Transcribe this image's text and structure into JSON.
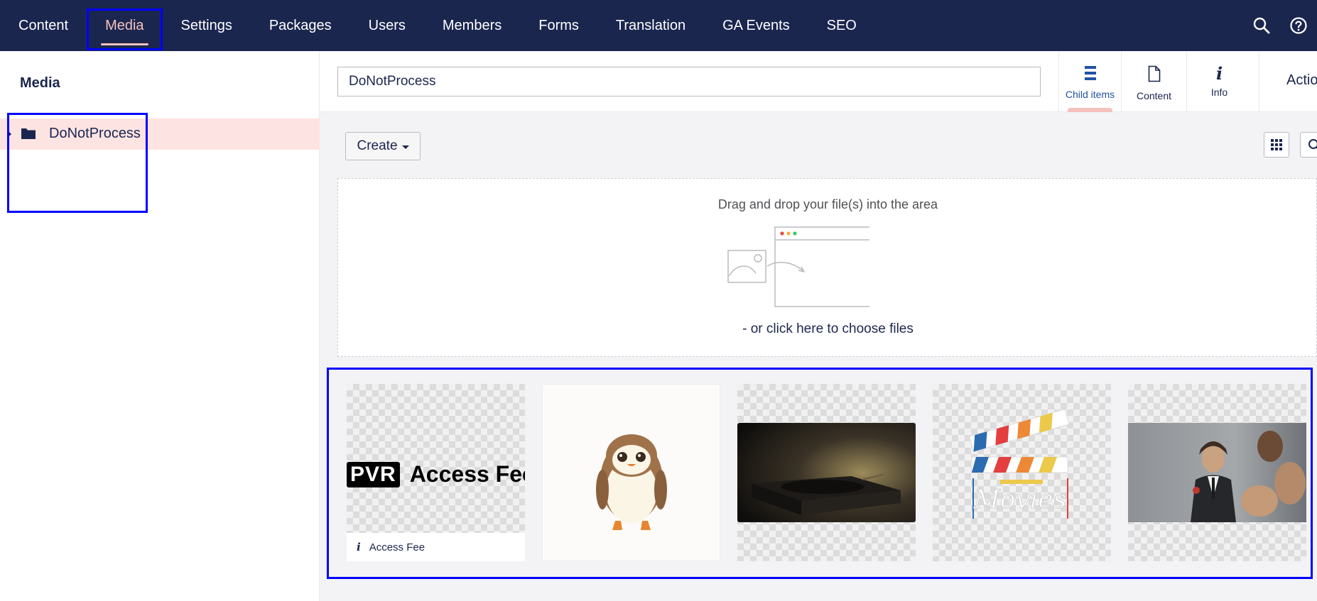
{
  "nav": {
    "items": [
      {
        "label": "Content"
      },
      {
        "label": "Media"
      },
      {
        "label": "Settings"
      },
      {
        "label": "Packages"
      },
      {
        "label": "Users"
      },
      {
        "label": "Members"
      },
      {
        "label": "Forms"
      },
      {
        "label": "Translation"
      },
      {
        "label": "GA Events"
      },
      {
        "label": "SEO"
      }
    ],
    "active": "Media",
    "icons": [
      "search-icon",
      "help-icon"
    ]
  },
  "tree": {
    "title": "Media",
    "nodes": [
      {
        "label": "DoNotProcess",
        "icon": "folder-icon",
        "selected": true
      }
    ]
  },
  "editor": {
    "name_value": "DoNotProcess",
    "tabs": [
      {
        "label": "Child items",
        "icon": "list-icon",
        "active": true
      },
      {
        "label": "Content",
        "icon": "document-icon"
      },
      {
        "label": "Info",
        "icon": "info-icon"
      }
    ],
    "actions_label": "Actions",
    "create_label": "Create"
  },
  "dropzone": {
    "title": "Drag and drop your file(s) into the area",
    "choose_text": "- or click here to choose files"
  },
  "media": {
    "items": [
      {
        "thumbnail": "PVR Access Fee logo",
        "caption": "Access Fee",
        "logo_box": "PVR",
        "logo_text": "Access Fee"
      },
      {
        "thumbnail": "porg illustration"
      },
      {
        "thumbnail": "turntable photo"
      },
      {
        "thumbnail": "movie clapperboard logo",
        "logo_text": "Movies"
      },
      {
        "thumbnail": "actors collage"
      }
    ]
  },
  "colors": {
    "header_bg": "#1b264f",
    "active_accent": "#f5c1bc",
    "selected_bg": "#fde4e2",
    "annotation_border": "#0000ff"
  }
}
